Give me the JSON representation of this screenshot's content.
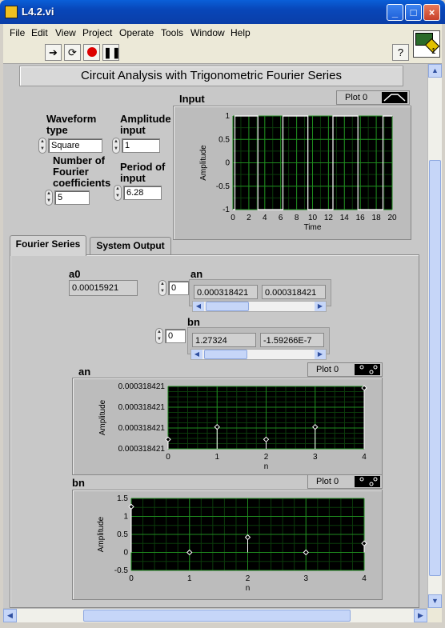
{
  "window": {
    "title": "L4.2.vi"
  },
  "menu": [
    "File",
    "Edit",
    "View",
    "Project",
    "Operate",
    "Tools",
    "Window",
    "Help"
  ],
  "vi_icon_label": "1",
  "panel_title": "Circuit Analysis with Trigonometric Fourier Series",
  "controls": {
    "waveform_type_label": "Waveform type",
    "waveform_type_value": "Square",
    "amplitude_label": "Amplitude of input",
    "amplitude_value": "1",
    "num_coeff_label": "Number of Fourier coefficients",
    "num_coeff_value": "5",
    "period_label": "Period of input",
    "period_value": "6.28"
  },
  "tabs": [
    "Fourier Series",
    "System Output"
  ],
  "fourier": {
    "a0_label": "a0",
    "a0_value": "0.00015921",
    "an_label": "an",
    "an_index": "0",
    "an_values": [
      "0.000318421",
      "0.000318421"
    ],
    "bn_label": "bn",
    "bn_index": "0",
    "bn_values": [
      "1.27324",
      "-1.59266E-7"
    ]
  },
  "chart_data": [
    {
      "type": "line",
      "title": "Input",
      "legend": "Plot 0",
      "xlabel": "Time",
      "ylabel": "Amplitude",
      "xlim": [
        0,
        20
      ],
      "ylim": [
        -1,
        1
      ],
      "x_ticks": [
        "0",
        "2",
        "4",
        "6",
        "8",
        "10",
        "12",
        "14",
        "16",
        "18",
        "20"
      ],
      "y_ticks": [
        "1",
        "0.5",
        "0",
        "-0.5",
        "-1"
      ],
      "series": [
        {
          "x": [
            0,
            0.25,
            0.25,
            3.14,
            3.14,
            6.28,
            6.28,
            9.42,
            9.42,
            12.56,
            12.56,
            15.7,
            15.7,
            18.84,
            18.84,
            20
          ],
          "y": [
            -1,
            -1,
            1,
            1,
            -1,
            -1,
            1,
            1,
            -1,
            -1,
            1,
            1,
            -1,
            -1,
            1,
            1
          ]
        }
      ]
    },
    {
      "type": "scatter",
      "title": "an",
      "legend": "Plot 0",
      "xlabel": "n",
      "ylabel": "Amplitude",
      "xlim": [
        0,
        4
      ],
      "ylim": [
        0,
        4
      ],
      "x_ticks": [
        "0",
        "1",
        "2",
        "3",
        "4"
      ],
      "y_ticks": [
        "0.000318421",
        "0.000318421",
        "0.000318421",
        "0.000318421"
      ],
      "series": [
        {
          "x": [
            0,
            1,
            2,
            3,
            4
          ],
          "y": [
            0.6,
            1.4,
            0.6,
            1.4,
            3.9
          ]
        }
      ]
    },
    {
      "type": "scatter",
      "title": "bn",
      "legend": "Plot 0",
      "xlabel": "n",
      "ylabel": "Amplitude",
      "xlim": [
        0,
        4
      ],
      "ylim": [
        -0.5,
        1.5
      ],
      "x_ticks": [
        "0",
        "1",
        "2",
        "3",
        "4"
      ],
      "y_ticks": [
        "1.5",
        "1",
        "0.5",
        "0",
        "-0.5"
      ],
      "series": [
        {
          "x": [
            0,
            1,
            2,
            3,
            4
          ],
          "y": [
            1.27,
            0,
            0.42,
            0,
            0.25
          ]
        }
      ]
    }
  ]
}
